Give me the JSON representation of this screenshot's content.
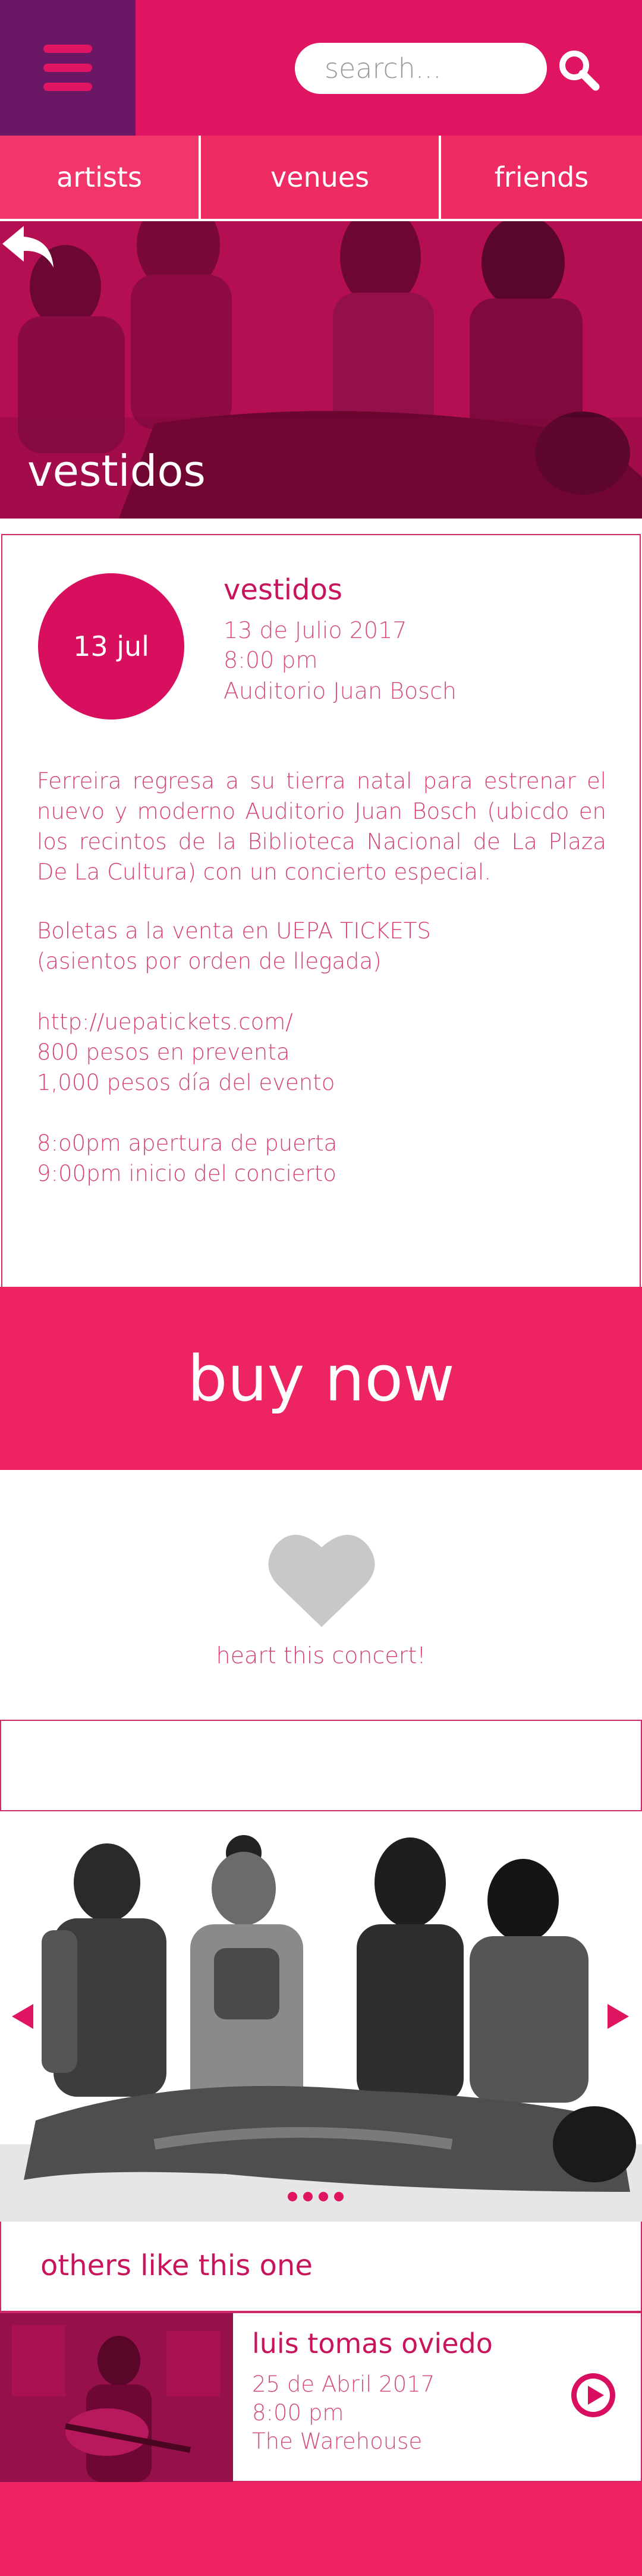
{
  "header": {
    "menu_icon": "hamburger-icon",
    "search_placeholder": "search...",
    "search_icon": "search-icon"
  },
  "nav": {
    "tabs": [
      {
        "label": "artists"
      },
      {
        "label": "venues"
      },
      {
        "label": "friends"
      }
    ]
  },
  "hero": {
    "back_icon": "back-arrow-icon",
    "title": "vestidos"
  },
  "event": {
    "date_badge": "13 jul",
    "name": "vestidos",
    "date": "13 de Julio 2017",
    "time": "8:00 pm",
    "venue": "Auditorio Juan Bosch",
    "description": "Ferreira regresa a su tierra natal para estrenar el nuevo y moderno Auditorio Juan Bosch (ubicdo en los recintos de la Biblioteca Nacional de La Plaza De La Cultura) con un concierto especial.",
    "tickets_line1": "Boletas a la venta en UEPA TICKETS",
    "tickets_line2": "(asientos por orden de llegada)",
    "url": "http://uepatickets.com/",
    "price_presale": "800 pesos en preventa",
    "price_day": "1,000 pesos día del evento",
    "doors_open": "8:o0pm apertura de puerta",
    "show_start": "9:00pm inicio del concierto"
  },
  "buy": {
    "label": "buy now"
  },
  "heart": {
    "icon": "heart-icon",
    "label": "heart this concert!",
    "color": "#c8c8c8"
  },
  "carousel": {
    "left_icon": "chevron-left-icon",
    "right_icon": "chevron-right-icon",
    "dot_count": 4
  },
  "others": {
    "title": "others like this one",
    "items": [
      {
        "name": "luis tomas oviedo",
        "date": "25 de Abril 2017",
        "time": "8:00 pm",
        "venue": "The Warehouse",
        "icon": "play-icon"
      }
    ]
  },
  "colors": {
    "brand": "#e01562",
    "menu_bg": "#6a1866",
    "accent_text": "#c8145c",
    "button": "#ee2462"
  }
}
